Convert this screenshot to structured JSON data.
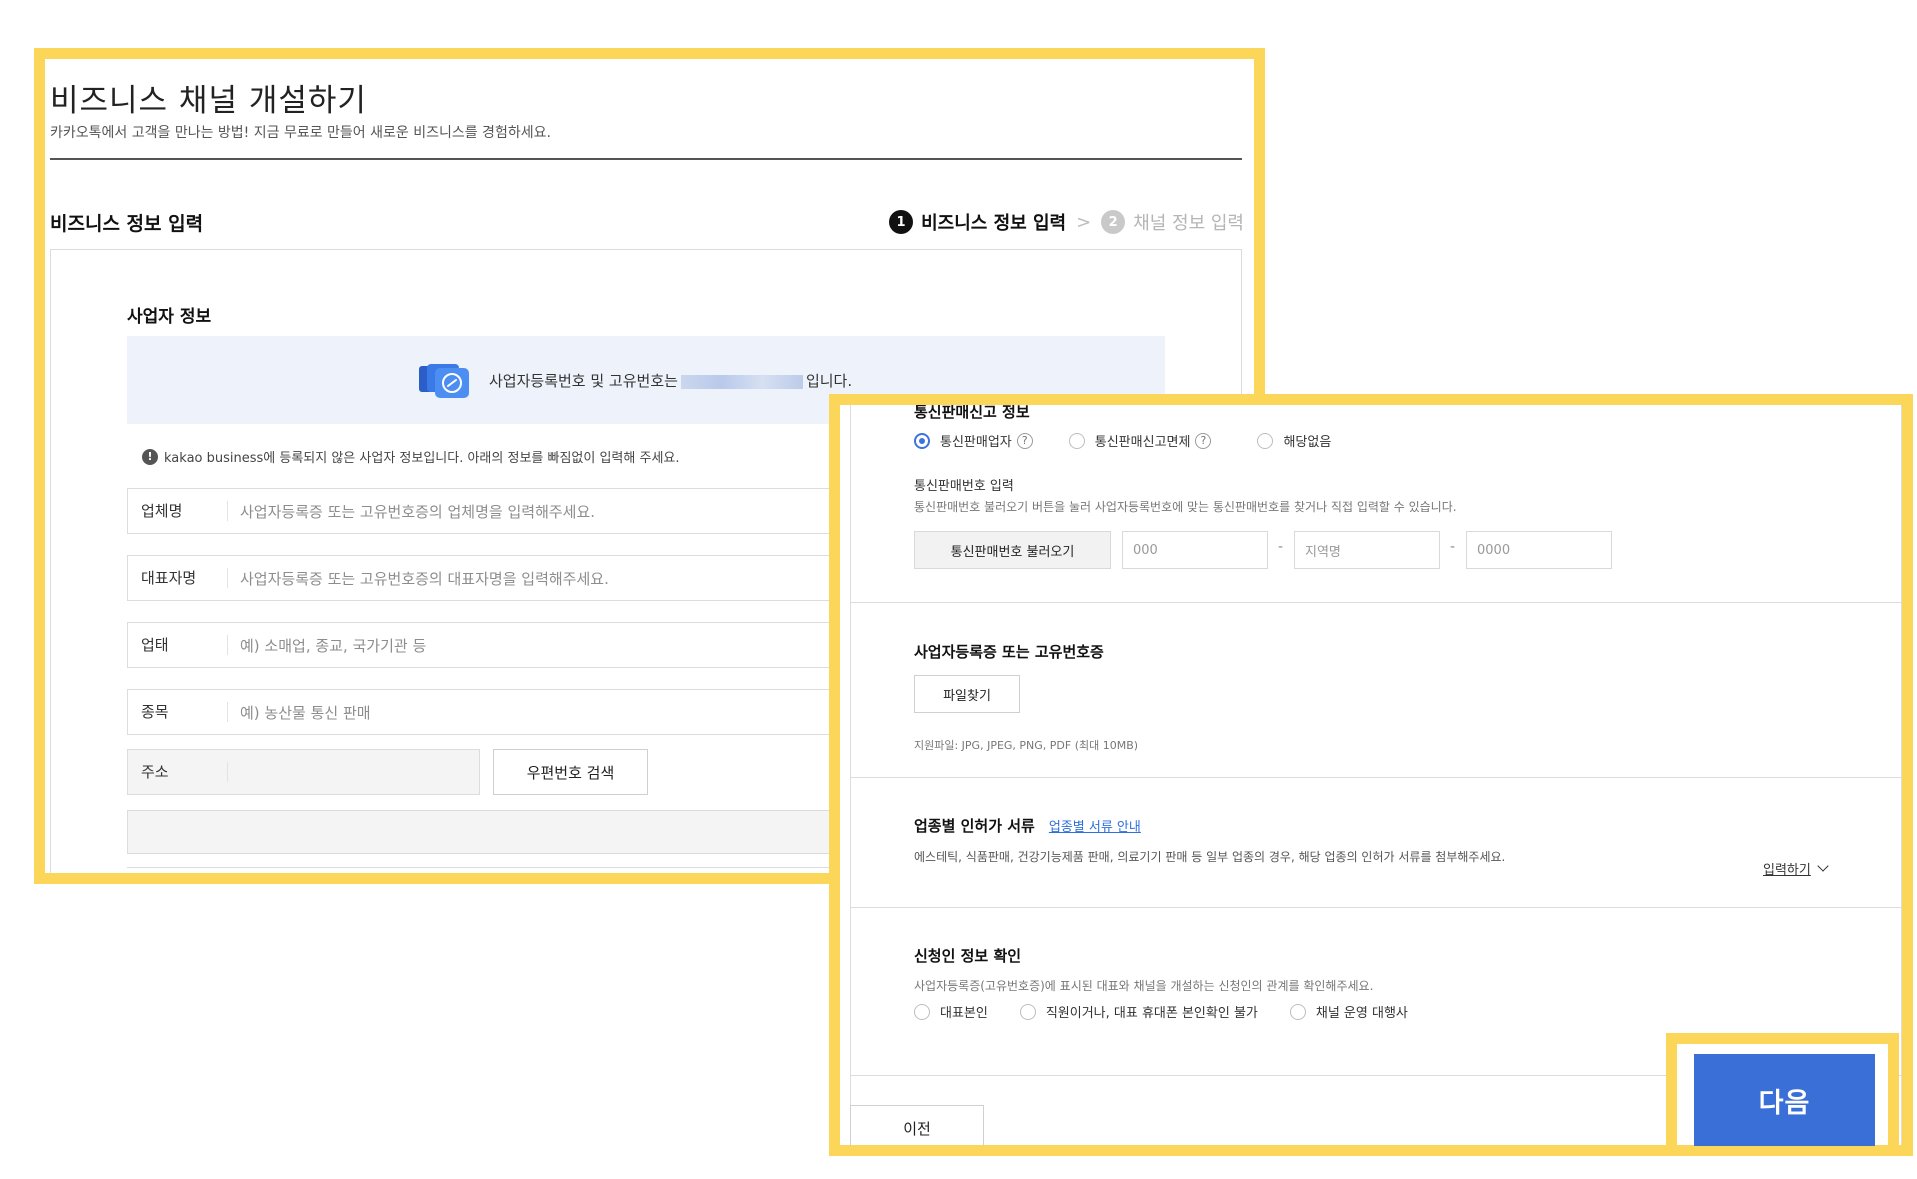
{
  "page": {
    "title": "비즈니스 채널 개설하기",
    "subtitle": "카카오톡에서 고객을 만나는 방법! 지금 무료로 만들어 새로운 비즈니스를 경험하세요.",
    "section_title": "비즈니스 정보 입력"
  },
  "steps": [
    {
      "num": "1",
      "label": "비즈니스 정보 입력",
      "active": true
    },
    {
      "num": "2",
      "label": "채널 정보 입력",
      "active": false
    }
  ],
  "business_info": {
    "heading": "사업자 정보",
    "notice_prefix": "사업자등록번호 및 고유번호는",
    "notice_suffix": "입니다.",
    "warning": "kakao business에 등록되지 않은 사업자 정보입니다. 아래의 정보를 빠짐없이 입력해 주세요.",
    "fields": [
      {
        "label": "업체명",
        "placeholder": "사업자등록증 또는 고유번호증의 업체명을 입력해주세요."
      },
      {
        "label": "대표자명",
        "placeholder": "사업자등록증 또는 고유번호증의 대표자명을 입력해주세요."
      },
      {
        "label": "업태",
        "placeholder": "예) 소매업, 종교, 국가기관 등"
      },
      {
        "label": "종목",
        "placeholder": "예) 농산물 통신 판매"
      }
    ],
    "address_label": "주소",
    "zip_button": "우편번호 검색"
  },
  "telecom": {
    "title": "통신판매신고 정보",
    "options": [
      "통신판매업자",
      "통신판매신고면제",
      "해당없음"
    ],
    "selected": "통신판매업자",
    "input_label": "통신판매번호 입력",
    "input_desc": "통신판매번호 불러오기 버튼을 눌러 사업자등록번호에 맞는 통신판매번호를 찾거나 직접 입력할 수 있습니다.",
    "load_button": "통신판매번호 불러오기",
    "placeholders": [
      "000",
      "지역명",
      "0000"
    ],
    "dash": "-"
  },
  "registration": {
    "title": "사업자등록증 또는 고유번호증",
    "file_button": "파일찾기",
    "file_hint": "지원파일: JPG, JPEG, PNG, PDF (최대 10MB)"
  },
  "license": {
    "title": "업종별 인허가 서류",
    "link": "업종별 서류 안내",
    "desc": "에스테틱, 식품판매, 건강기능제품 판매, 의료기기 판매 등 일부 업종의 경우, 해당 업종의 인허가 서류를 첨부해주세요.",
    "toggle": "입력하기"
  },
  "applicant": {
    "title": "신청인 정보 확인",
    "desc": "사업자등록증(고유번호증)에 표시된 대표와 채널을 개설하는 신청인의 관계를 확인해주세요.",
    "options": [
      "대표본인",
      "직원이거나, 대표 휴대폰 본인확인 불가",
      "채널 운영 대행사"
    ]
  },
  "nav": {
    "prev": "이전",
    "next": "다음"
  },
  "colors": {
    "highlight": "#fcd659",
    "primary": "#3a6fd8",
    "link": "#2f6fdb"
  }
}
